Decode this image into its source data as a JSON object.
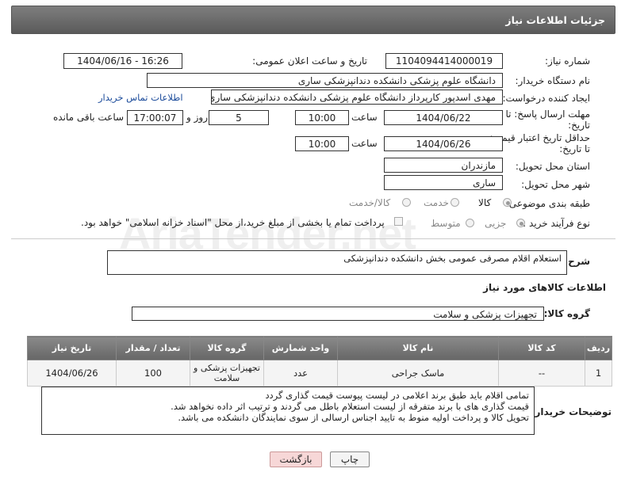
{
  "header": {
    "title": "جزئیات اطلاعات نیاز"
  },
  "form": {
    "need_number_label": "شماره نیاز:",
    "need_number": "1104094414000019",
    "announce_label": "تاریخ و ساعت اعلان عمومی:",
    "announce_value": "1404/06/16 - 16:26",
    "buyer_org_label": "نام دستگاه خریدار:",
    "buyer_org": "دانشگاه علوم پزشکی دانشکده دندانپزشکی ساری",
    "creator_label": "ایجاد کننده درخواست:",
    "creator": "مهدی اسدپور کارپرداز دانشگاه علوم پزشکی دانشکده دندانپزشکی ساری",
    "contact_link": "اطلاعات تماس خریدار",
    "deadline_label_1": "مهلت ارسال پاسخ: تا",
    "deadline_label_2": "تاریخ:",
    "deadline_date": "1404/06/22",
    "time_label": "ساعت",
    "deadline_time": "10:00",
    "days_value": "5",
    "days_label": "روز و",
    "remaining_time": "17:00:07",
    "remaining_label": "ساعت باقی مانده",
    "validity_label_1": "حداقل تاریخ اعتبار قیمت:",
    "validity_label_2": "تا تاریخ:",
    "validity_date": "1404/06/26",
    "validity_time": "10:00",
    "province_label": "استان محل تحویل:",
    "province": "مازندران",
    "city_label": "شهر محل تحویل:",
    "city": "ساری",
    "category_label": "طبقه بندی موضوعی:",
    "category_options": [
      "کالا",
      "خدمت",
      "کالا/خدمت"
    ],
    "process_label": "نوع فرآیند خرید :",
    "process_options": [
      "جزیی",
      "متوسط"
    ],
    "payment_note": "پرداخت تمام یا بخشی از مبلغ خرید،از محل \"اسناد خزانه اسلامی\" خواهد بود."
  },
  "description": {
    "label": "شرح کلی نیاز:",
    "text": "استعلام اقلام مصرفی عمومی بخش دانشکده دندانپزشکی"
  },
  "goods": {
    "section_title": "اطلاعات کالاهای مورد نیاز",
    "group_label": "گروه کالا:",
    "group_value": "تجهیزات پزشکی و سلامت",
    "columns": [
      "ردیف",
      "کد کالا",
      "نام کالا",
      "واحد شمارش",
      "گروه کالا",
      "تعداد / مقدار",
      "تاریخ نیاز"
    ],
    "rows": [
      [
        "1",
        "--",
        "ماسک جراحی",
        "عدد",
        "تجهیزات پزشکی و سلامت",
        "100",
        "1404/06/26"
      ]
    ]
  },
  "buyer_notes": {
    "label": "توضیحات خریدار:",
    "lines": [
      "تمامی اقلام باید طبق برند اعلامی در لیست پیوست قیمت گذاری گردد",
      "قیمت گذاری های با برند متفرقه از لیست استعلام باطل می گردند و ترتیب اثر داده نخواهد شد.",
      "تحویل کالا و پرداخت اولیه منوط به تایید اجناس ارسالی از سوی نمایندگان دانشکده می باشد."
    ]
  },
  "buttons": {
    "print": "چاپ",
    "back": "بازگشت"
  },
  "colors": {
    "header_bg": "#6a6a6a",
    "link": "#1a4a9a",
    "back_button": "#f7d7d7"
  }
}
